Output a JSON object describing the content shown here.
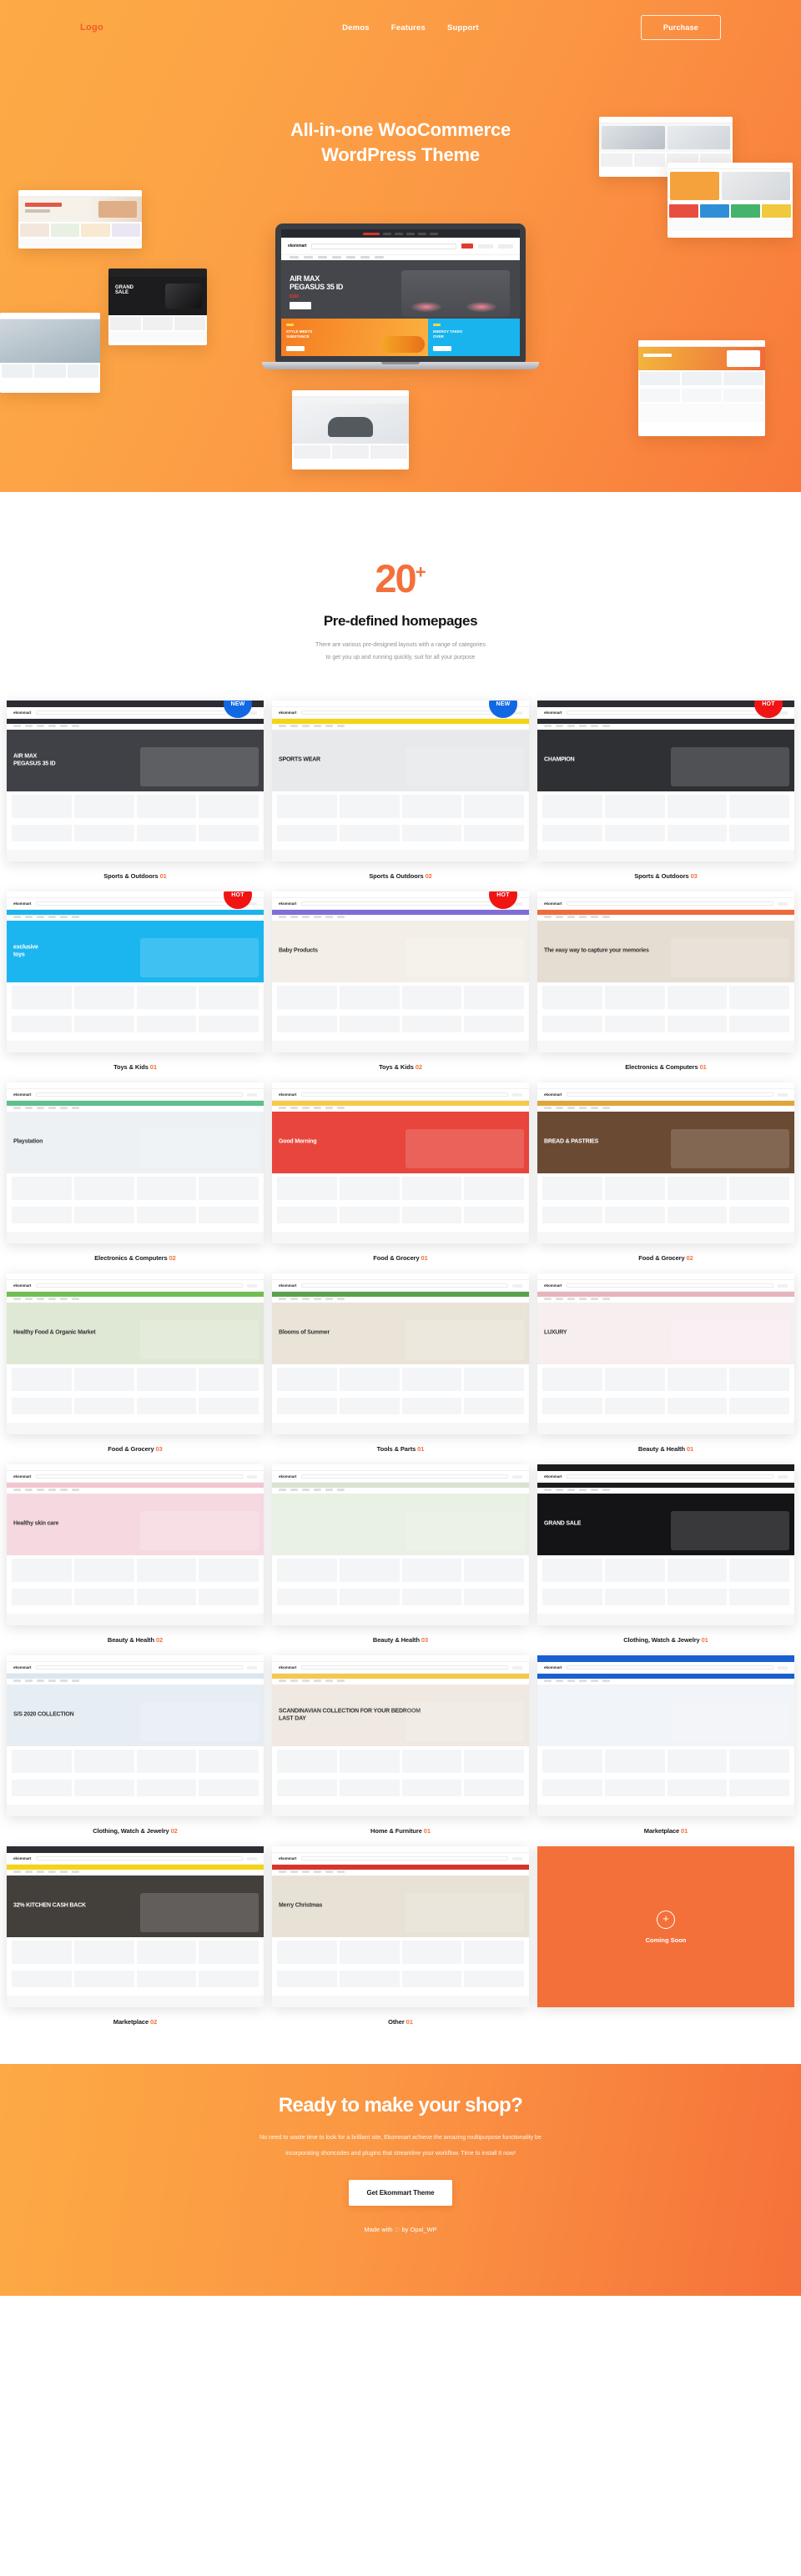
{
  "header": {
    "logo": "Logo",
    "nav": [
      {
        "label": "Demos"
      },
      {
        "label": "Features"
      },
      {
        "label": "Support"
      }
    ],
    "purchase_label": "Purchase"
  },
  "hero": {
    "title_line1": "All-in-one WooCommerce",
    "title_line2": "WordPress Theme",
    "laptop_screen": {
      "brand": "ekommart",
      "headline_line1": "AIR MAX",
      "headline_line2": "PEGASUS 35 ID",
      "price": "$190",
      "cta": "Shop Now",
      "banner1_title_line1": "STYLE MEETS",
      "banner1_title_line2": "SUBSTANCE",
      "banner1_cta": "Find Your Shoe",
      "banner2_title_line1": "ENERGY TAKES",
      "banner2_title_line2": "OVER",
      "banner2_cta": "New Everyday"
    }
  },
  "demos_section": {
    "count": "20",
    "count_suffix": "+",
    "title": "Pre-defined homepages",
    "subtitle_line1": "There are various pre-designed layouts with a range of categories",
    "subtitle_line2": "to get you up and running quickly, suit for all your purpose",
    "colors": {
      "accent": "#f4703a",
      "badge_new": "#1268e3",
      "badge_hot": "#f01414"
    },
    "cards": [
      {
        "name": "Sports & Outdoors",
        "number": "01",
        "badge": "NEW",
        "badge_type": "new",
        "theme": "sports-dark"
      },
      {
        "name": "Sports & Outdoors",
        "number": "02",
        "badge": "NEW",
        "badge_type": "new",
        "theme": "sports-yellow"
      },
      {
        "name": "Sports & Outdoors",
        "number": "03",
        "badge": "HOT",
        "badge_type": "hot",
        "theme": "sports-champion"
      },
      {
        "name": "Toys & Kids",
        "number": "01",
        "badge": "HOT",
        "badge_type": "hot",
        "theme": "toys-blue"
      },
      {
        "name": "Toys & Kids",
        "number": "02",
        "badge": "HOT",
        "badge_type": "hot",
        "theme": "toys-baby"
      },
      {
        "name": "Electronics & Computers",
        "number": "01",
        "badge": "",
        "badge_type": "",
        "theme": "electronics-orange"
      },
      {
        "name": "Electronics & Computers",
        "number": "02",
        "badge": "",
        "badge_type": "",
        "theme": "electronics-green"
      },
      {
        "name": "Food & Grocery",
        "number": "01",
        "badge": "",
        "badge_type": "",
        "theme": "food-red"
      },
      {
        "name": "Food & Grocery",
        "number": "02",
        "badge": "",
        "badge_type": "",
        "theme": "food-bakery"
      },
      {
        "name": "Food & Grocery",
        "number": "03",
        "badge": "",
        "badge_type": "",
        "theme": "food-organic"
      },
      {
        "name": "Tools & Parts",
        "number": "01",
        "badge": "",
        "badge_type": "",
        "theme": "tools-green"
      },
      {
        "name": "Beauty & Health",
        "number": "01",
        "badge": "",
        "badge_type": "",
        "theme": "beauty-luxury"
      },
      {
        "name": "Beauty & Health",
        "number": "02",
        "badge": "",
        "badge_type": "",
        "theme": "beauty-pink"
      },
      {
        "name": "Beauty & Health",
        "number": "03",
        "badge": "",
        "badge_type": "",
        "theme": "beauty-leaf"
      },
      {
        "name": "Clothing, Watch & Jewelry",
        "number": "01",
        "badge": "",
        "badge_type": "",
        "theme": "watch-dark"
      },
      {
        "name": "Clothing, Watch & Jewelry",
        "number": "02",
        "badge": "",
        "badge_type": "",
        "theme": "clothing-ss"
      },
      {
        "name": "Home & Furniture",
        "number": "01",
        "badge": "",
        "badge_type": "",
        "theme": "furniture"
      },
      {
        "name": "Marketplace",
        "number": "01",
        "badge": "",
        "badge_type": "",
        "theme": "market-blue"
      },
      {
        "name": "Marketplace",
        "number": "02",
        "badge": "",
        "badge_type": "",
        "theme": "market-dark"
      },
      {
        "name": "Other",
        "number": "01",
        "badge": "",
        "badge_type": "",
        "theme": "other-xmas"
      }
    ],
    "coming_soon": {
      "label": "Coming Soon",
      "icon": "plus-icon"
    },
    "card_overlays": {
      "c0_h1": "AIR MAX",
      "c0_h2": "PEGASUS 35 ID",
      "c1_h1": "SPORTS WEAR",
      "c2_h1": "CHAMPION",
      "c3_h1": "exclusive",
      "c3_h2": "toys",
      "c4_h1": "Baby Products",
      "c5_h1": "The easy way to capture your memories",
      "c6_h1": "Playstation",
      "c7_h1": "Good Morning",
      "c8_h1": "BREAD & PASTRIES",
      "c9_h1": "Healthy Food & Organic Market",
      "c10_h1": "Blooms of Summer",
      "c11_h1": "LUXURY",
      "c12_h1": "Healthy skin care",
      "c14_h1": "GRAND SALE",
      "c15_h1": "S/S 2020 COLLECTION",
      "c16_h1": "SCANDINAVIAN COLLECTION FOR YOUR BEDROOM LAST DAY",
      "c18_h1": "32% KITCHEN CASH BACK",
      "c19_h1": "Merry Christmas"
    }
  },
  "cta": {
    "title": "Ready to make your shop?",
    "desc_line1": "No need to waste time to look for a brilliant site, Ekommart achieve the amazing multipurpose functionality be",
    "desc_line2": "incorporating shortcodes and plugins that streamline your workflow. Time to install It now!",
    "button_label": "Get Ekommart Theme",
    "made_prefix": "Made with ",
    "made_heart": "♡",
    "made_suffix": " by Opal_WP"
  }
}
